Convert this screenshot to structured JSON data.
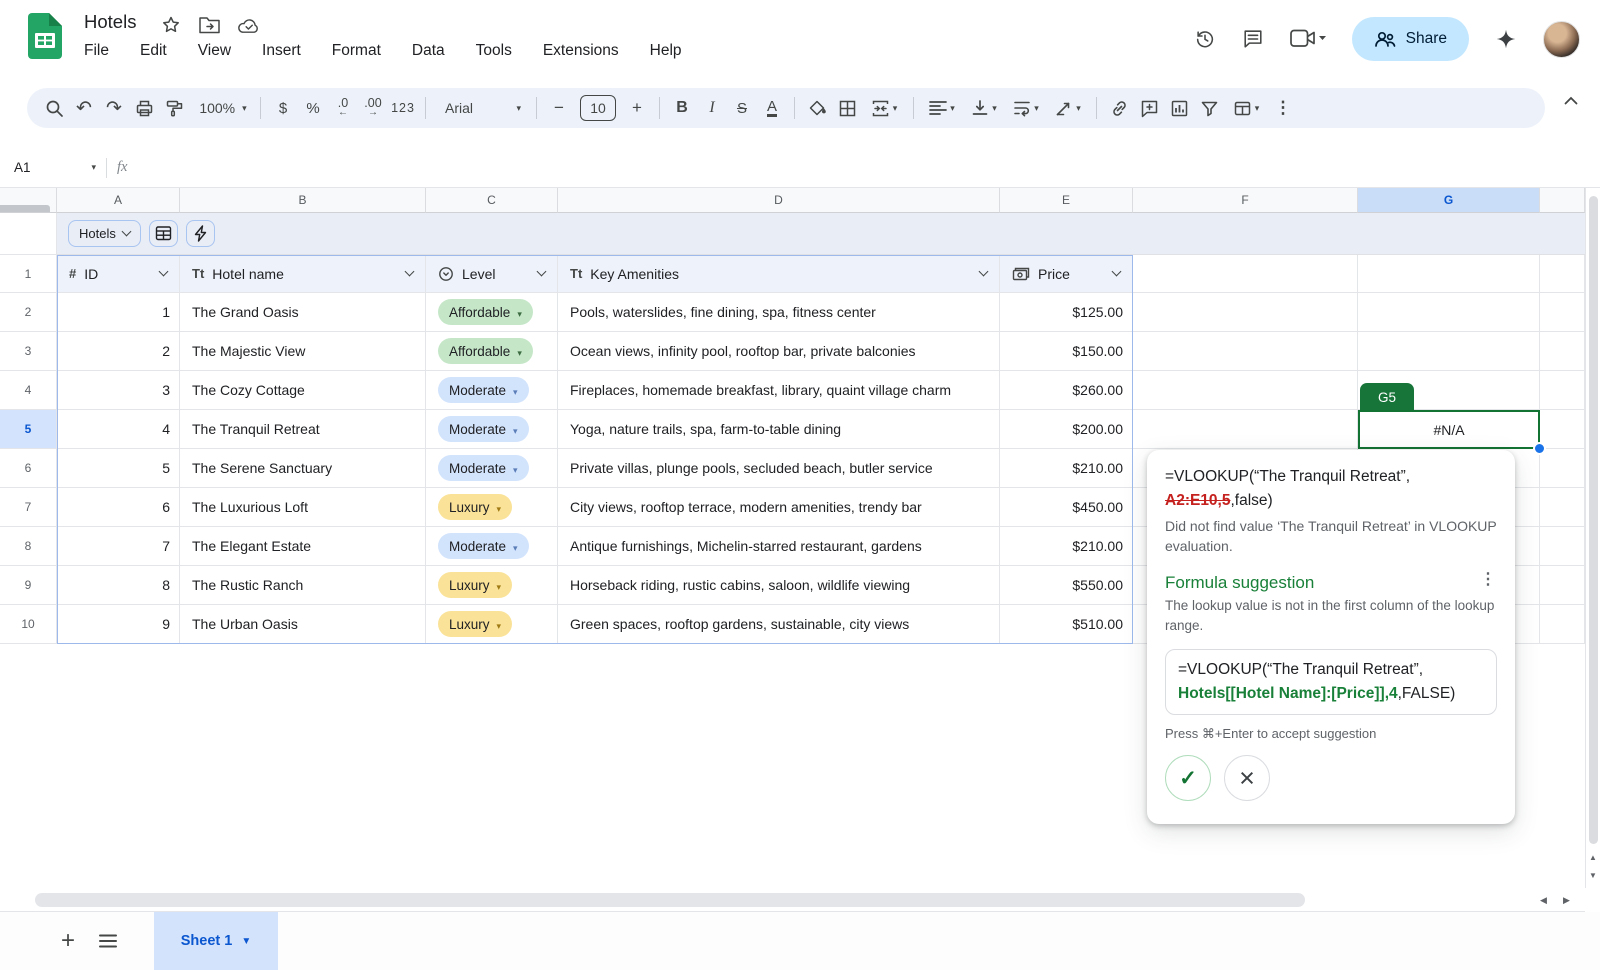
{
  "titlebar": {
    "title": "Hotels",
    "menus": [
      "File",
      "Edit",
      "View",
      "Insert",
      "Format",
      "Data",
      "Tools",
      "Extensions",
      "Help"
    ],
    "share_label": "Share"
  },
  "toolbar": {
    "zoom": "100%",
    "font_name": "Arial",
    "font_size": "10",
    "glyphs": {
      "undo": "↶",
      "redo": "↷",
      "currency": "$",
      "percent": "%",
      "dec_dec": ".0",
      "dec_dec_arrow": "←",
      "dec_inc": ".00",
      "dec_inc_arrow": "→",
      "plain_number": "123",
      "minus": "−",
      "plus": "+",
      "bold": "B",
      "italic": "I",
      "strike": "S",
      "text_color": "A",
      "more": "⋮"
    }
  },
  "formula_bar": {
    "cell_ref": "A1",
    "fx_label": "fx"
  },
  "sheet": {
    "column_letters": [
      "A",
      "B",
      "C",
      "D",
      "E",
      "F",
      "G"
    ],
    "selected_column": "G",
    "selected_row": "5"
  },
  "table": {
    "chip_label": "Hotels",
    "header_row_n": "1",
    "header_icons": {
      "id": "#",
      "text": "Tt"
    },
    "headers": {
      "id": "ID",
      "name": "Hotel name",
      "level": "Level",
      "amenities": "Key Amenities",
      "price": "Price"
    },
    "rows": [
      {
        "n": "2",
        "id": "1",
        "name": "The Grand Oasis",
        "level": "Affordable",
        "level_key": "affordable",
        "amenities": "Pools, waterslides, fine dining, spa, fitness center",
        "price": "$125.00"
      },
      {
        "n": "3",
        "id": "2",
        "name": "The Majestic View",
        "level": "Affordable",
        "level_key": "affordable",
        "amenities": "Ocean views, infinity pool, rooftop bar, private balconies",
        "price": "$150.00"
      },
      {
        "n": "4",
        "id": "3",
        "name": "The Cozy Cottage",
        "level": "Moderate",
        "level_key": "moderate",
        "amenities": "Fireplaces, homemade breakfast, library, quaint village charm",
        "price": "$260.00"
      },
      {
        "n": "5",
        "id": "4",
        "name": "The Tranquil Retreat",
        "level": "Moderate",
        "level_key": "moderate",
        "amenities": "Yoga, nature trails, spa, farm-to-table dining",
        "price": "$200.00"
      },
      {
        "n": "6",
        "id": "5",
        "name": "The Serene Sanctuary",
        "level": "Moderate",
        "level_key": "moderate",
        "amenities": "Private villas, plunge pools, secluded beach, butler service",
        "price": "$210.00"
      },
      {
        "n": "7",
        "id": "6",
        "name": "The Luxurious Loft",
        "level": "Luxury",
        "level_key": "luxury",
        "amenities": "City views, rooftop terrace, modern amenities, trendy bar",
        "price": "$450.00"
      },
      {
        "n": "8",
        "id": "7",
        "name": "The Elegant Estate",
        "level": "Moderate",
        "level_key": "moderate",
        "amenities": "Antique furnishings, Michelin-starred restaurant, gardens",
        "price": "$210.00"
      },
      {
        "n": "9",
        "id": "8",
        "name": "The Rustic Ranch",
        "level": "Luxury",
        "level_key": "luxury",
        "amenities": "Horseback riding, rustic cabins, saloon, wildlife viewing",
        "price": "$550.00"
      },
      {
        "n": "10",
        "id": "9",
        "name": "The Urban Oasis",
        "level": "Luxury",
        "level_key": "luxury",
        "amenities": "Green spaces, rooftop gardens, sustainable, city views",
        "price": "$510.00"
      }
    ]
  },
  "selection": {
    "cell_tab": "G5",
    "cell_value": "#N/A"
  },
  "popup": {
    "formula_prefix": "=VLOOKUP(“The Tranquil Retreat”,",
    "formula_invalid": "A2:E10,5",
    "formula_suffix": ",false)",
    "error_text": "Did not find value ‘The Tranquil Retreat’ in VLOOKUP evaluation.",
    "suggestion_title": "Formula suggestion",
    "menu_glyph": "⋮",
    "suggestion_desc": "The lookup value is not in the first column of the lookup range.",
    "suggestion_prefix": "=VLOOKUP(“The Tranquil Retreat”,",
    "suggestion_highlight": "Hotels[[Hotel Name]:[Price]],4",
    "suggestion_suffix": ",FALSE)",
    "hint": "Press ⌘+Enter to accept suggestion",
    "accept_glyph": "✓",
    "reject_glyph": "×"
  },
  "bottom": {
    "active_sheet": "Sheet 1"
  },
  "colors": {
    "accent_blue": "#0b57d0",
    "selection_green": "#137333",
    "suggestion_green": "#188038",
    "error_red": "#c5221f",
    "share_pill": "#c2e7ff",
    "toolbar_bg": "#edf2fa",
    "pill_affordable": "#c5e7c8",
    "pill_moderate": "#d2e3fc",
    "pill_luxury": "#fae298",
    "selected_header": "#c9dcf8",
    "fill_handle_blue": "#1a73e8"
  }
}
